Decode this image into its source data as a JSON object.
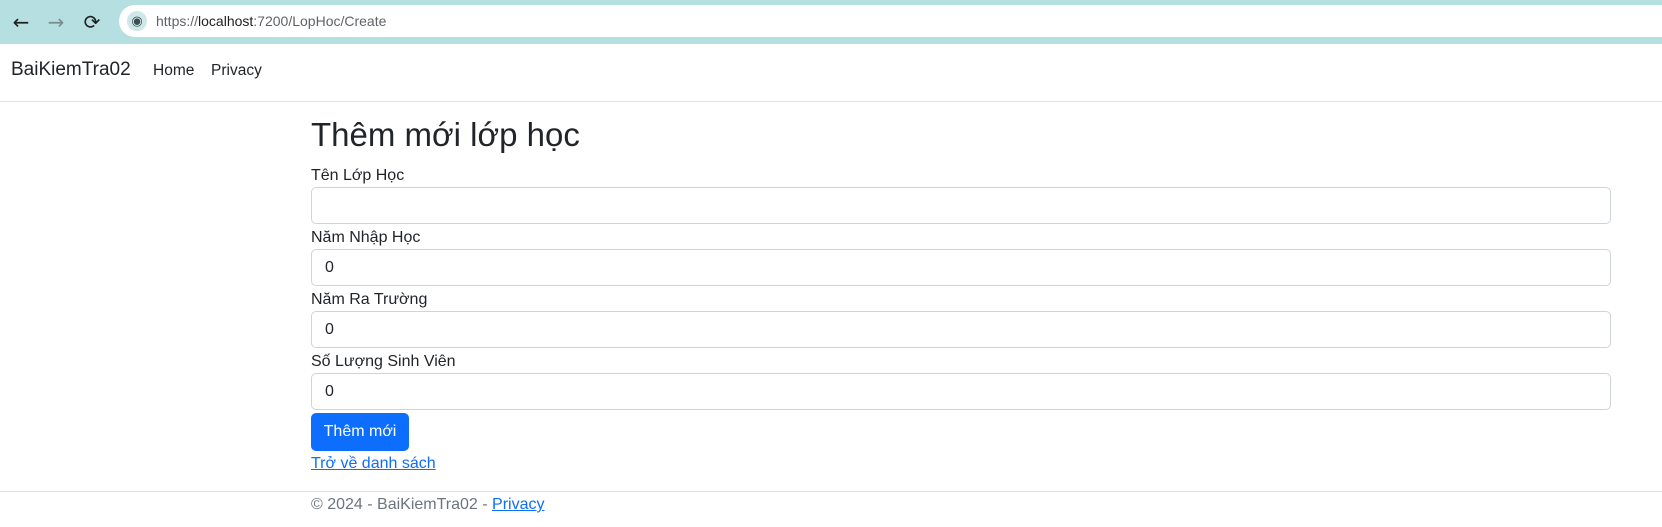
{
  "browser": {
    "back_icon": "←",
    "forward_icon": "→",
    "reload_icon": "⟳",
    "site_icon": "◉",
    "url_prefix": "https://",
    "url_host": "localhost",
    "url_path": ":7200/LopHoc/Create"
  },
  "navbar": {
    "brand": "BaiKiemTra02",
    "links": [
      "Home",
      "Privacy"
    ]
  },
  "form": {
    "title": "Thêm mới lớp học",
    "fields": [
      {
        "label": "Tên Lớp Học",
        "value": ""
      },
      {
        "label": "Năm Nhập Học",
        "value": "0"
      },
      {
        "label": "Năm Ra Trường",
        "value": "0"
      },
      {
        "label": "Số Lượng Sinh Viên",
        "value": "0"
      }
    ],
    "submit_label": "Thêm mới",
    "back_link": "Trở về danh sách"
  },
  "footer": {
    "text": "© 2024 - BaiKiemTra02 - ",
    "link": "Privacy"
  },
  "colors": {
    "primary": "#0d6efd",
    "browser_bar": "#b5dfe0"
  }
}
